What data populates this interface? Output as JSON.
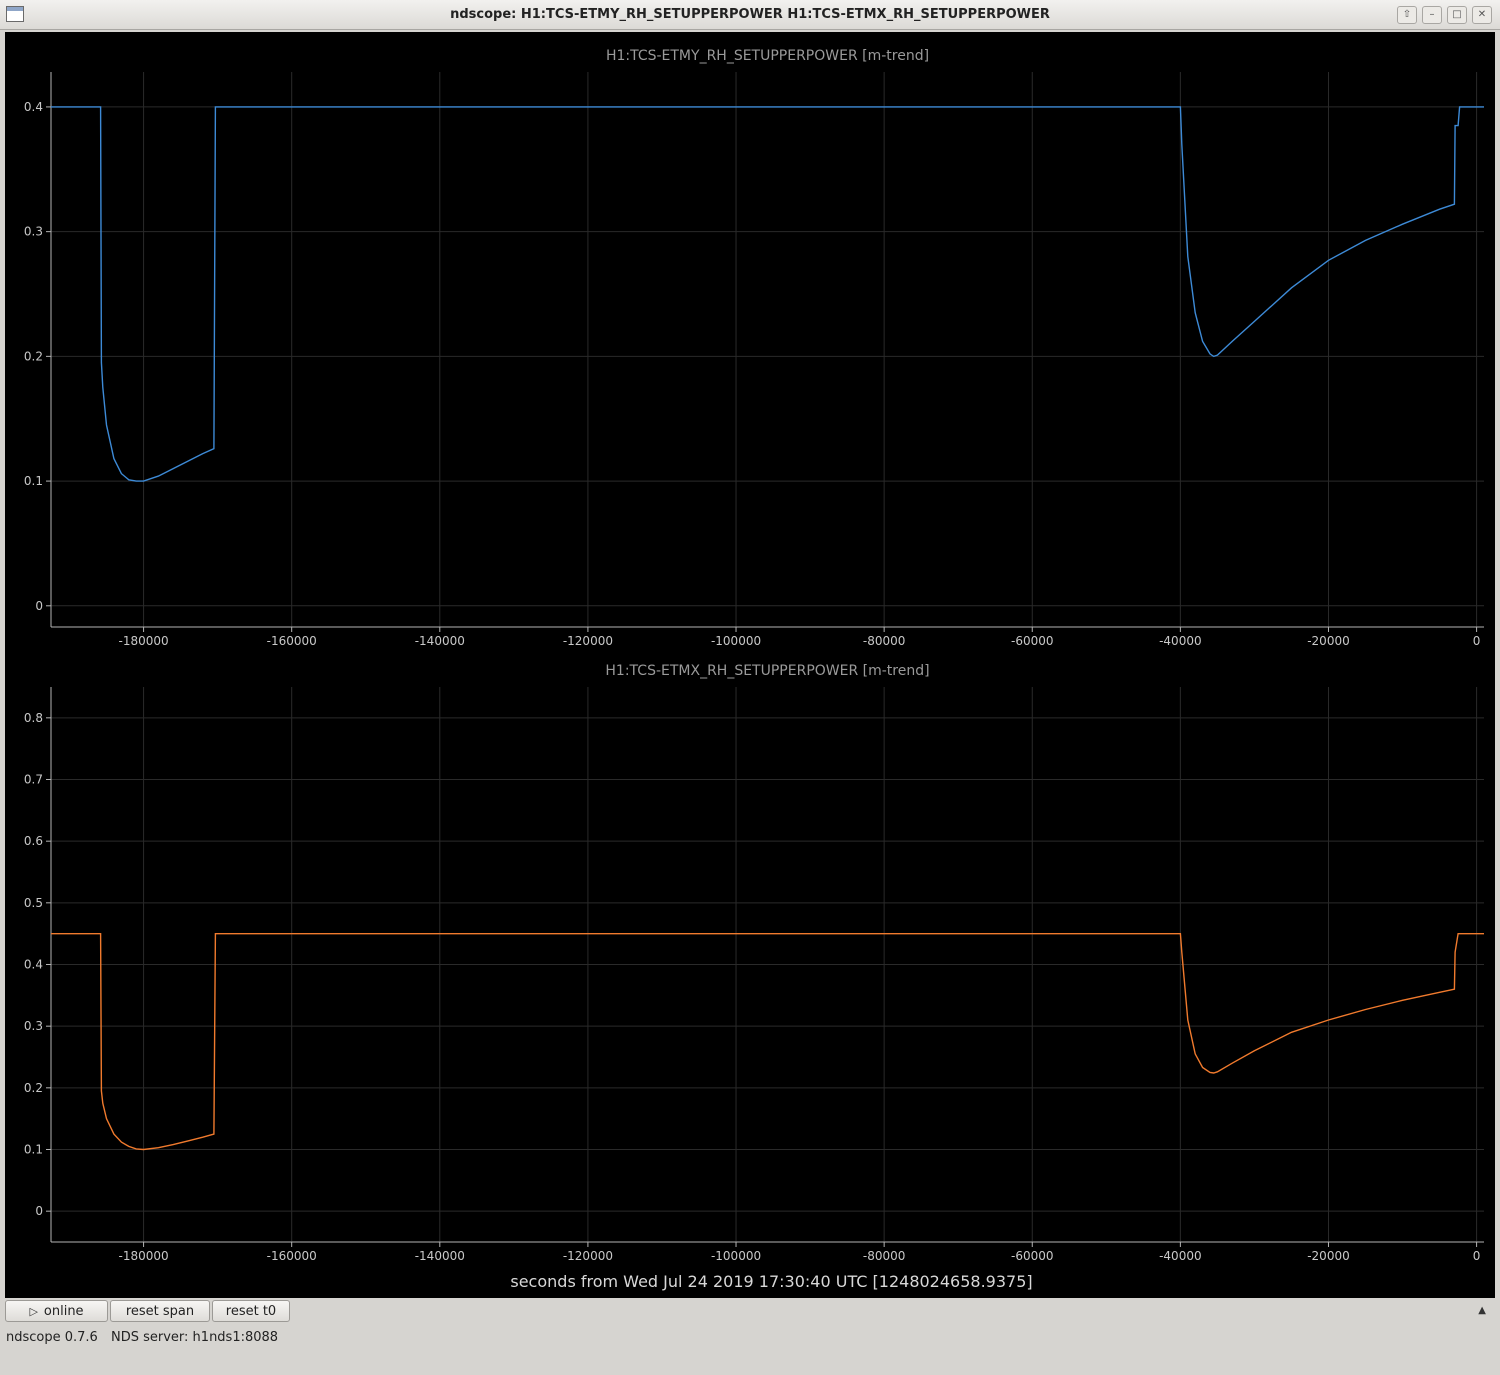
{
  "window": {
    "title": "ndscope: H1:TCS-ETMY_RH_SETUPPERPOWER H1:TCS-ETMX_RH_SETUPPERPOWER"
  },
  "toolbar": {
    "online_label": "online",
    "reset_span_label": "reset span",
    "reset_t0_label": "reset t0"
  },
  "status": {
    "version": "ndscope 0.7.6",
    "server": "NDS server: h1nds1:8088"
  },
  "colors": {
    "background": "#000000",
    "grid": "#2a2a2a",
    "axis": "#b4b4b4",
    "text": "#c8c8c8",
    "etmy": "#3d8ad6",
    "etmx": "#f07a2d"
  },
  "chart_data": [
    {
      "type": "line",
      "title": "H1:TCS-ETMY_RH_SETUPPERPOWER [m-trend]",
      "xlabel": "",
      "ylabel": "",
      "xlim": [
        -192500,
        1000
      ],
      "ylim": [
        -0.017,
        0.428
      ],
      "x_ticks": [
        -180000,
        -160000,
        -140000,
        -120000,
        -100000,
        -80000,
        -60000,
        -40000,
        -20000,
        0
      ],
      "y_ticks": [
        0,
        0.1,
        0.2,
        0.3,
        0.4
      ],
      "grid": true,
      "series": [
        {
          "x": [
            -192500,
            -185800,
            -185700,
            -185500,
            -185000,
            -184000,
            -183000,
            -182000,
            -181000,
            -180000,
            -178000,
            -176000,
            -174000,
            -172000,
            -170500,
            -170300,
            -170000,
            -40000,
            -39800,
            -39000,
            -38000,
            -37000,
            -36000,
            -35500,
            -35000,
            -33000,
            -30000,
            -25000,
            -20000,
            -15000,
            -10000,
            -5000,
            -3000,
            -2900,
            -2500,
            -2300,
            1000
          ],
          "y": [
            0.4,
            0.4,
            0.195,
            0.175,
            0.145,
            0.118,
            0.106,
            0.101,
            0.1,
            0.1,
            0.104,
            0.11,
            0.116,
            0.122,
            0.126,
            0.4,
            0.4,
            0.4,
            0.37,
            0.28,
            0.235,
            0.212,
            0.202,
            0.2,
            0.201,
            0.212,
            0.228,
            0.255,
            0.277,
            0.293,
            0.306,
            0.318,
            0.322,
            0.385,
            0.385,
            0.4,
            0.4
          ]
        }
      ]
    },
    {
      "type": "line",
      "title": "H1:TCS-ETMX_RH_SETUPPERPOWER [m-trend]",
      "xlabel": "seconds from Wed Jul 24 2019 17:30:40 UTC [1248024658.9375]",
      "ylabel": "",
      "xlim": [
        -192500,
        1000
      ],
      "ylim": [
        -0.05,
        0.85
      ],
      "x_ticks": [
        -180000,
        -160000,
        -140000,
        -120000,
        -100000,
        -80000,
        -60000,
        -40000,
        -20000,
        0
      ],
      "y_ticks": [
        0,
        0.1,
        0.2,
        0.3,
        0.4,
        0.5,
        0.6,
        0.7,
        0.8
      ],
      "grid": true,
      "series": [
        {
          "x": [
            -192500,
            -185800,
            -185700,
            -185500,
            -185000,
            -184000,
            -183000,
            -182000,
            -181000,
            -180000,
            -178000,
            -176000,
            -174000,
            -172000,
            -170500,
            -170300,
            -170000,
            -40000,
            -39800,
            -39000,
            -38000,
            -37000,
            -36000,
            -35500,
            -35000,
            -33000,
            -30000,
            -25000,
            -20000,
            -15000,
            -10000,
            -5000,
            -3000,
            -2900,
            -2500,
            -2300,
            1000
          ],
          "y": [
            0.45,
            0.45,
            0.195,
            0.175,
            0.15,
            0.125,
            0.112,
            0.105,
            0.101,
            0.1,
            0.103,
            0.108,
            0.114,
            0.12,
            0.125,
            0.45,
            0.45,
            0.45,
            0.42,
            0.31,
            0.255,
            0.233,
            0.225,
            0.224,
            0.226,
            0.24,
            0.26,
            0.29,
            0.31,
            0.327,
            0.342,
            0.355,
            0.36,
            0.42,
            0.45,
            0.45,
            0.45
          ]
        }
      ]
    }
  ]
}
